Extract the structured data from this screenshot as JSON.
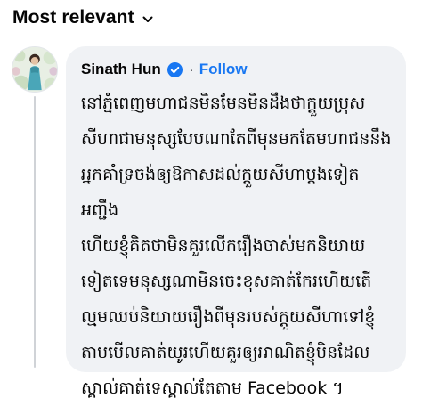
{
  "sort": {
    "label": "Most relevant",
    "icon": "chevron-down-icon"
  },
  "comment": {
    "author": "Sinath Hun",
    "verified": true,
    "separator": "·",
    "follow_label": "Follow",
    "text": "នៅភ្នំពេញមហាជនមិនមែនមិនដឹងថាក្តួយប្រុស\nសីហាជាមនុស្សបែបណាតែពីមុនមកតែមហាជននឹង\nអ្នកគាំទ្រចង់ឲ្យឱកាសដល់ក្តួយសីហាម្តងទៀតអញ្ជឹង\nហើយខ្ញុំគិតថាមិនគួរលើករឿងចាស់មកនិយាយ\nទៀតទេមនុស្សណាមិនចេះខុសគាត់កែរហើយតើ\nល្មមឈប់និយាយរឿងពីមុនរបស់ក្តួយសីហាទៅខ្ញុំ\nតាមមើលគាត់យូរហើយគួរឲ្យអាណិតខ្ញុំមិនដែល\nស្គាល់គាត់ទេស្គាល់តែតាម Facebook ។"
  },
  "colors": {
    "bubble": "#f0f2f5",
    "link": "#1877f2",
    "verified": "#1877f2",
    "text": "#050505",
    "muted": "#65676b"
  }
}
